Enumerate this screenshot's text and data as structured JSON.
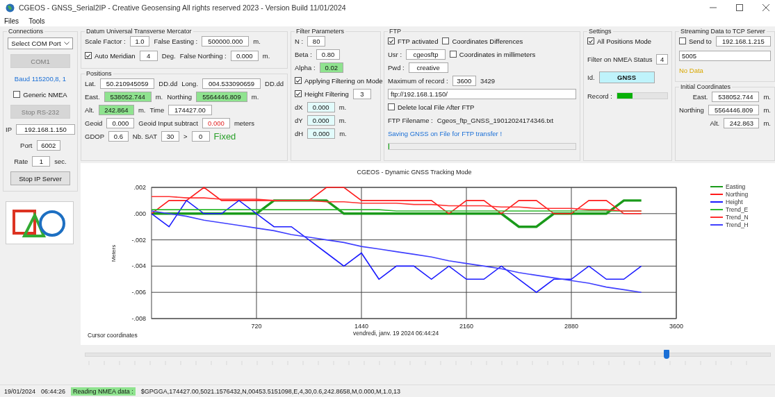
{
  "window": {
    "title": "CGEOS - GNSS_Serial2IP - Creative Geosensing All rights reserved 2023 - Version Build 11/01/2024"
  },
  "menu": [
    "Files",
    "Tools"
  ],
  "panel_columns": [
    [
      {
        "title": "Connections",
        "rows": [
          {
            "items": [
              {
                "kind": "select",
                "value": "Select COM Port"
              }
            ]
          },
          {
            "items": [
              {
                "kind": "button",
                "label": "COM1",
                "disabled": true
              }
            ]
          },
          {
            "items": [
              {
                "kind": "note-info",
                "text": "Baud 115200,8, 1"
              }
            ]
          },
          {
            "items": [
              {
                "kind": "check",
                "label": "Generic NMEA",
                "checked": false
              }
            ]
          },
          {
            "items": [
              {
                "kind": "button",
                "label": "Stop RS-232",
                "disabled": true
              }
            ]
          },
          {
            "items": [
              {
                "kind": "text",
                "text": "IP"
              },
              {
                "kind": "field",
                "value": "192.168.1.150"
              }
            ]
          },
          {
            "items": [
              {
                "kind": "text",
                "text": "Port"
              },
              {
                "kind": "field",
                "value": "6002"
              }
            ]
          },
          {
            "items": [
              {
                "kind": "text",
                "text": "Rate"
              },
              {
                "kind": "field",
                "value": "1"
              },
              {
                "kind": "text",
                "text": "sec."
              }
            ]
          },
          {
            "items": [
              {
                "kind": "button",
                "label": "Stop IP Server",
                "disabled": false
              }
            ]
          }
        ]
      }
    ],
    [
      {
        "title": "Datum Universal Transverse Mercator",
        "rows": [
          {
            "items": [
              {
                "kind": "text",
                "text": "Scale Factor :"
              },
              {
                "kind": "field",
                "value": "1.0"
              },
              {
                "kind": "text",
                "text": "False Easting :"
              },
              {
                "kind": "field",
                "value": "500000.000"
              },
              {
                "kind": "text",
                "text": "m."
              }
            ]
          },
          {
            "items": [
              {
                "kind": "check",
                "label": "Auto Meridian",
                "checked": true
              },
              {
                "kind": "field",
                "value": "4"
              },
              {
                "kind": "text",
                "text": "Deg."
              },
              {
                "kind": "text",
                "text": "False Northing :"
              },
              {
                "kind": "field",
                "value": "0.000"
              },
              {
                "kind": "text",
                "text": "m."
              }
            ]
          }
        ]
      },
      {
        "title": "Positions",
        "rows": [
          {
            "items": [
              {
                "kind": "text",
                "text": "Lat."
              },
              {
                "kind": "field",
                "value": "50.210945059"
              },
              {
                "kind": "text",
                "text": "DD.dd"
              },
              {
                "kind": "text",
                "text": "Long."
              },
              {
                "kind": "field",
                "value": "004.533090659"
              },
              {
                "kind": "text",
                "text": "DD.dd"
              }
            ]
          },
          {
            "items": [
              {
                "kind": "text",
                "text": "East."
              },
              {
                "kind": "field-ok",
                "value": "538052.744"
              },
              {
                "kind": "text",
                "text": "m."
              },
              {
                "kind": "text",
                "text": "Northing"
              },
              {
                "kind": "field-ok",
                "value": "5564446.809"
              },
              {
                "kind": "text",
                "text": "m."
              }
            ]
          },
          {
            "items": [
              {
                "kind": "text",
                "text": "Alt."
              },
              {
                "kind": "field-ok",
                "value": "242.864"
              },
              {
                "kind": "text",
                "text": "m."
              },
              {
                "kind": "text",
                "text": "Time"
              },
              {
                "kind": "field",
                "value": "174427.00"
              }
            ]
          },
          {
            "items": [
              {
                "kind": "text",
                "text": "Geoid"
              },
              {
                "kind": "field",
                "value": "0.000"
              },
              {
                "kind": "text",
                "text": "Geoid Input subtract"
              },
              {
                "kind": "field-alert",
                "value": "0.000"
              },
              {
                "kind": "text",
                "text": "meters"
              }
            ]
          },
          {
            "items": [
              {
                "kind": "text",
                "text": "GDOP"
              },
              {
                "kind": "field",
                "value": "0.6"
              },
              {
                "kind": "text",
                "text": "Nb. SAT"
              },
              {
                "kind": "field",
                "value": "30"
              },
              {
                "kind": "text",
                "text": ">"
              },
              {
                "kind": "field",
                "value": "0"
              },
              {
                "kind": "note-ok",
                "text": "Fixed"
              }
            ]
          }
        ]
      }
    ],
    [
      {
        "title": "Filter Parameters",
        "rows": [
          {
            "items": [
              {
                "kind": "text",
                "text": "N :"
              },
              {
                "kind": "field",
                "value": "80"
              }
            ]
          },
          {
            "items": [
              {
                "kind": "text",
                "text": "Beta :"
              },
              {
                "kind": "field",
                "value": "0.80"
              }
            ]
          },
          {
            "items": [
              {
                "kind": "text",
                "text": "Alpha :"
              },
              {
                "kind": "field-ok",
                "value": "0.02"
              }
            ]
          },
          {
            "items": [
              {
                "kind": "check",
                "label": "Applying Filtering on Mode",
                "checked": true
              }
            ]
          },
          {
            "items": [
              {
                "kind": "check",
                "label": "Height Filtering",
                "checked": true
              },
              {
                "kind": "field",
                "value": "3"
              }
            ]
          },
          {
            "items": [
              {
                "kind": "text",
                "text": "dX"
              },
              {
                "kind": "field-info",
                "value": "0.000"
              },
              {
                "kind": "text",
                "text": "m."
              }
            ]
          },
          {
            "items": [
              {
                "kind": "text",
                "text": "dY"
              },
              {
                "kind": "field-info",
                "value": "0.000"
              },
              {
                "kind": "text",
                "text": "m."
              }
            ]
          },
          {
            "items": [
              {
                "kind": "text",
                "text": "dH"
              },
              {
                "kind": "field-info",
                "value": "0.000"
              },
              {
                "kind": "text",
                "text": "m."
              }
            ]
          }
        ]
      }
    ],
    [
      {
        "title": "FTP",
        "rows": [
          {
            "items": [
              {
                "kind": "check",
                "label": "FTP activated",
                "checked": true
              },
              {
                "kind": "check",
                "label": "Coordinates Differences",
                "checked": false
              }
            ]
          },
          {
            "items": [
              {
                "kind": "text",
                "text": "Usr :"
              },
              {
                "kind": "field",
                "value": "cgeosftp"
              },
              {
                "kind": "check",
                "label": "Coordinates in millimeters",
                "checked": false
              }
            ]
          },
          {
            "items": [
              {
                "kind": "text",
                "text": "Pwd :"
              },
              {
                "kind": "field",
                "value": "creative"
              }
            ]
          },
          {
            "items": [
              {
                "kind": "text",
                "text": "Maximum of record :"
              },
              {
                "kind": "field",
                "value": "3600"
              },
              {
                "kind": "text",
                "text": "3429"
              }
            ]
          },
          {
            "items": [
              {
                "kind": "field",
                "value": "ftp://192.168.1.150/"
              }
            ]
          },
          {
            "items": [
              {
                "kind": "check",
                "label": "Delete local File After FTP",
                "checked": false
              }
            ]
          },
          {
            "items": [
              {
                "kind": "text",
                "text": "FTP Filename :"
              },
              {
                "kind": "text",
                "text": "Cgeos_ftp_GNSS_19012024174346.txt"
              }
            ]
          },
          {
            "items": [
              {
                "kind": "note-info",
                "text": "Saving GNSS on File for FTP transfer !"
              }
            ]
          },
          {
            "items": [
              {
                "kind": "meter",
                "level": 0
              }
            ]
          }
        ]
      }
    ],
    [
      {
        "title": "Settings",
        "rows": [
          {
            "items": [
              {
                "kind": "check",
                "label": "All Positions Mode",
                "checked": true
              }
            ]
          },
          {
            "items": [
              {
                "kind": "text",
                "text": "Filter on NMEA Status"
              },
              {
                "kind": "field",
                "value": "4"
              }
            ]
          },
          {
            "items": [
              {
                "kind": "text",
                "text": "Id."
              },
              {
                "kind": "field-id",
                "value": "GNSS"
              }
            ]
          },
          {
            "items": [
              {
                "kind": "text",
                "text": "Record :"
              },
              {
                "kind": "meter",
                "level": 0.3
              }
            ]
          }
        ]
      }
    ],
    [
      {
        "title": "Streaming Data to TCP Server",
        "rows": [
          {
            "items": [
              {
                "kind": "check",
                "label": "Send to",
                "checked": false
              },
              {
                "kind": "field",
                "value": "192.168.1.215"
              }
            ]
          },
          {
            "items": [
              {
                "kind": "field",
                "value": "5005"
              }
            ]
          },
          {
            "items": [
              {
                "kind": "note-warn",
                "text": "No Data"
              }
            ]
          }
        ]
      },
      {
        "title": "Initial Coordinates",
        "rows": [
          {
            "items": [
              {
                "kind": "text",
                "text": "East."
              },
              {
                "kind": "field",
                "value": "538052.744"
              },
              {
                "kind": "text",
                "text": "m."
              }
            ]
          },
          {
            "items": [
              {
                "kind": "text",
                "text": "Northing"
              },
              {
                "kind": "field",
                "value": "5564446.809"
              },
              {
                "kind": "text",
                "text": "m."
              }
            ]
          },
          {
            "items": [
              {
                "kind": "text",
                "text": "Alt."
              },
              {
                "kind": "field",
                "value": "242.863"
              },
              {
                "kind": "text",
                "text": "m."
              }
            ]
          }
        ]
      }
    ]
  ],
  "chart": {
    "cursor_label": "Cursor coordinates",
    "timestamp": "vendredi, janv. 19 2024 06:44:24",
    "chart_data": {
      "type": "line",
      "title": "CGEOS - Dynamic GNSS Tracking Mode",
      "ylabel": "Meters",
      "grid": true,
      "legend": true,
      "x": [
        0,
        120,
        240,
        360,
        480,
        600,
        720,
        840,
        960,
        1080,
        1200,
        1320,
        1440,
        1560,
        1680,
        1800,
        1920,
        2040,
        2160,
        2280,
        2400,
        2520,
        2640,
        2760,
        2880,
        3000,
        3120,
        3240,
        3360
      ],
      "xlim": [
        0,
        3600
      ],
      "ylim": [
        -0.008,
        0.002
      ],
      "xticks": [
        720,
        1440,
        2160,
        2880,
        3600
      ],
      "yticks": [
        {
          "value": 0.002,
          "label": ".002"
        },
        {
          "value": 0,
          "label": ".000"
        },
        {
          "value": -0.002,
          "label": "-.002"
        },
        {
          "value": -0.004,
          "label": "-.004"
        },
        {
          "value": -0.006,
          "label": "-.006"
        },
        {
          "value": -0.008,
          "label": "-.008"
        }
      ],
      "series": [
        {
          "name": "Easting",
          "color": "#1a9a1a",
          "values": [
            0,
            0,
            0,
            0,
            0,
            0,
            0,
            0.001,
            0.001,
            0.001,
            0.001,
            0,
            0,
            0,
            0,
            0,
            0,
            0,
            0,
            0,
            0,
            -0.001,
            -0.001,
            0,
            0,
            0,
            0,
            0.001,
            0.001
          ]
        },
        {
          "name": "Northing",
          "color": "#ff1a1a",
          "values": [
            0,
            0.001,
            0.001,
            0.002,
            0.001,
            0.001,
            0.001,
            0.001,
            0.001,
            0.001,
            0.002,
            0.002,
            0.001,
            0.001,
            0.001,
            0.001,
            0.001,
            0,
            0.001,
            0.001,
            0,
            0.001,
            0.001,
            0,
            0,
            0.001,
            0.001,
            0,
            0
          ]
        },
        {
          "name": "Height",
          "color": "#1a1aff",
          "values": [
            0,
            -0.001,
            0.001,
            0,
            0,
            0.001,
            0,
            -0.001,
            -0.001,
            -0.002,
            -0.003,
            -0.004,
            -0.003,
            -0.005,
            -0.004,
            -0.004,
            -0.005,
            -0.004,
            -0.005,
            -0.005,
            -0.004,
            -0.005,
            -0.006,
            -0.005,
            -0.005,
            -0.004,
            -0.005,
            -0.005,
            -0.004
          ]
        },
        {
          "name": "Trend_E",
          "color": "#2db82d",
          "values": [
            0.0003,
            0.0003,
            0.0003,
            0.0003,
            0.0003,
            0.0003,
            0.0003,
            0.0003,
            0.0003,
            0.0003,
            0.0003,
            0.0003,
            0.0003,
            0.0003,
            0.0002,
            0.0002,
            0.0002,
            0.0002,
            0.0002,
            0.0002,
            0.0002,
            0.0002,
            0.0002,
            0.0002,
            0.0002,
            0.0002,
            0.0002,
            0.0002,
            0.0002
          ]
        },
        {
          "name": "Trend_N",
          "color": "#ff3030",
          "values": [
            0.0013,
            0.0013,
            0.0012,
            0.0012,
            0.0011,
            0.0011,
            0.0011,
            0.001,
            0.001,
            0.001,
            0.0009,
            0.0009,
            0.0008,
            0.0008,
            0.0008,
            0.0007,
            0.0007,
            0.0006,
            0.0006,
            0.0006,
            0.0005,
            0.0005,
            0.0004,
            0.0004,
            0.0004,
            0.0003,
            0.0003,
            0.0002,
            0.0002
          ]
        },
        {
          "name": "Trend_H",
          "color": "#4040ff",
          "values": [
            0.0002,
            0,
            -0.0002,
            -0.0005,
            -0.0007,
            -0.0009,
            -0.0011,
            -0.0013,
            -0.0016,
            -0.0018,
            -0.002,
            -0.0022,
            -0.0025,
            -0.0027,
            -0.0029,
            -0.0031,
            -0.0033,
            -0.0036,
            -0.0038,
            -0.004,
            -0.0042,
            -0.0045,
            -0.0047,
            -0.0049,
            -0.0051,
            -0.0053,
            -0.0056,
            -0.0058,
            -0.006
          ]
        }
      ]
    }
  },
  "slider": {
    "level": 0.84
  },
  "status_bar": {
    "date": "19/01/2024",
    "time": "06:44:26",
    "label": "Reading NMEA data :",
    "sentence": "$GPGGA,174427.00,5021.1576432,N,00453.5151098,E,4,30,0.6,242.8658,M,0.000,M,1.0,13"
  }
}
